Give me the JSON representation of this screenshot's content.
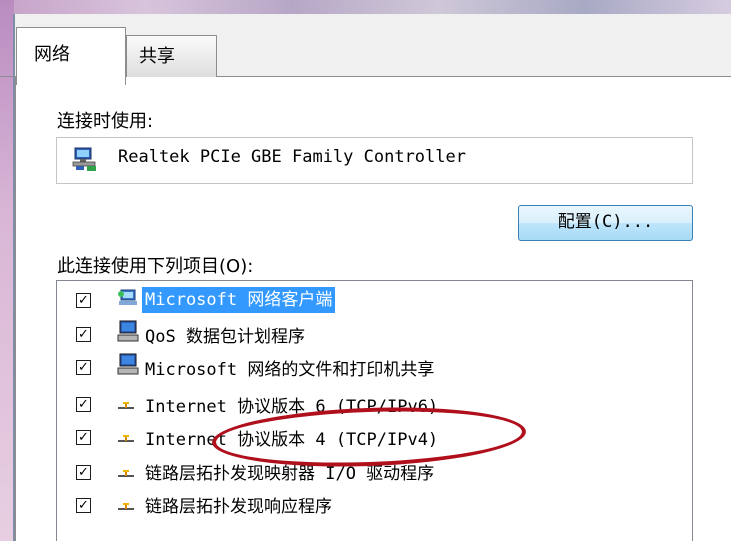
{
  "tabs": [
    {
      "label": "网络",
      "active": true
    },
    {
      "label": "共享",
      "active": false
    }
  ],
  "connect_using_label": "连接时使用:",
  "adapter": {
    "name": "Realtek PCIe GBE Family Controller",
    "icon": "network-adapter-icon"
  },
  "config_button_label": "配置(C)...",
  "items_label": "此连接使用下列项目(O):",
  "items": [
    {
      "label": "Microsoft 网络客户端",
      "checked": true,
      "icon": "network-client-icon",
      "selected": true
    },
    {
      "label": "QoS 数据包计划程序",
      "checked": true,
      "icon": "computer-service-icon",
      "selected": false
    },
    {
      "label": "Microsoft 网络的文件和打印机共享",
      "checked": true,
      "icon": "computer-service-icon",
      "selected": false
    },
    {
      "label": "Internet 协议版本 6 (TCP/IPv6)",
      "checked": true,
      "icon": "protocol-icon",
      "selected": false
    },
    {
      "label": "Internet 协议版本 4 (TCP/IPv4)",
      "checked": true,
      "icon": "protocol-icon",
      "selected": false,
      "annotated": true
    },
    {
      "label": "链路层拓扑发现映射器 I/O 驱动程序",
      "checked": true,
      "icon": "protocol-icon",
      "selected": false
    },
    {
      "label": "链路层拓扑发现响应程序",
      "checked": true,
      "icon": "protocol-icon",
      "selected": false
    }
  ],
  "colors": {
    "selection": "#3399ff",
    "annotation": "#b0101c",
    "button_border": "#3c7fb1"
  }
}
